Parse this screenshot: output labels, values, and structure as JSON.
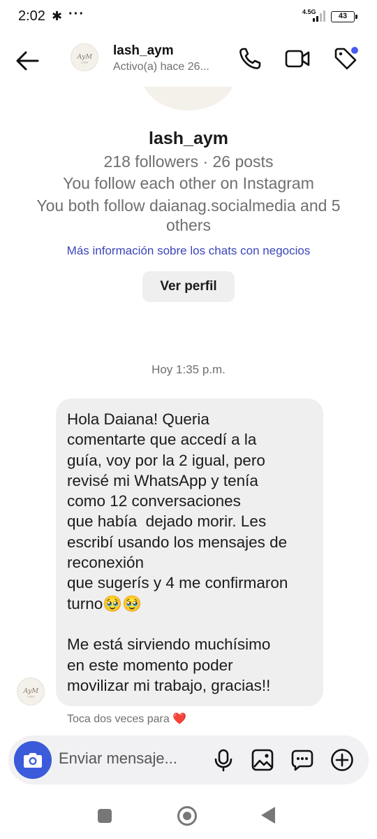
{
  "status_bar": {
    "time": "2:02",
    "notification_icon": "slack-icon",
    "more": "···",
    "network": "4.5G",
    "battery": "43"
  },
  "header": {
    "username": "lash_aym",
    "status": "Activo(a) hace 26...",
    "avatar_logo": "AyM"
  },
  "profile": {
    "name": "lash_aym",
    "stats": "218 followers · 26 posts",
    "follow_status": "You follow each other on Instagram",
    "mutual": "You both follow daianag.socialmedia and 5 others",
    "business_link": "Más información sobre los chats con negocios",
    "view_profile_label": "Ver perfil"
  },
  "thread": {
    "timestamp": "Hoy 1:35 p.m.",
    "message": "Hola Daiana! Queria\ncomentarte que accedí a la\nguía, voy por la 2 igual, pero\nrevisé mi WhatsApp y tenía\ncomo 12 conversaciones\nque había  dejado morir. Les\nescribí usando los mensajes de\nreconexión\nque sugerís y 4 me confirmaron\nturno🥹🥹\n\nMe está sirviendo muchísimo\nen este momento poder\nmovilizar mi trabajo, gracias!!",
    "double_tap_hint": "Toca dos veces para",
    "heart": "❤️"
  },
  "composer": {
    "placeholder": "Enviar mensaje..."
  },
  "colors": {
    "accent": "#3b5bdb",
    "link": "#3b46b8",
    "bubble": "#efefef",
    "heart": "#e0282e",
    "notification_dot": "#4a5cf0"
  }
}
